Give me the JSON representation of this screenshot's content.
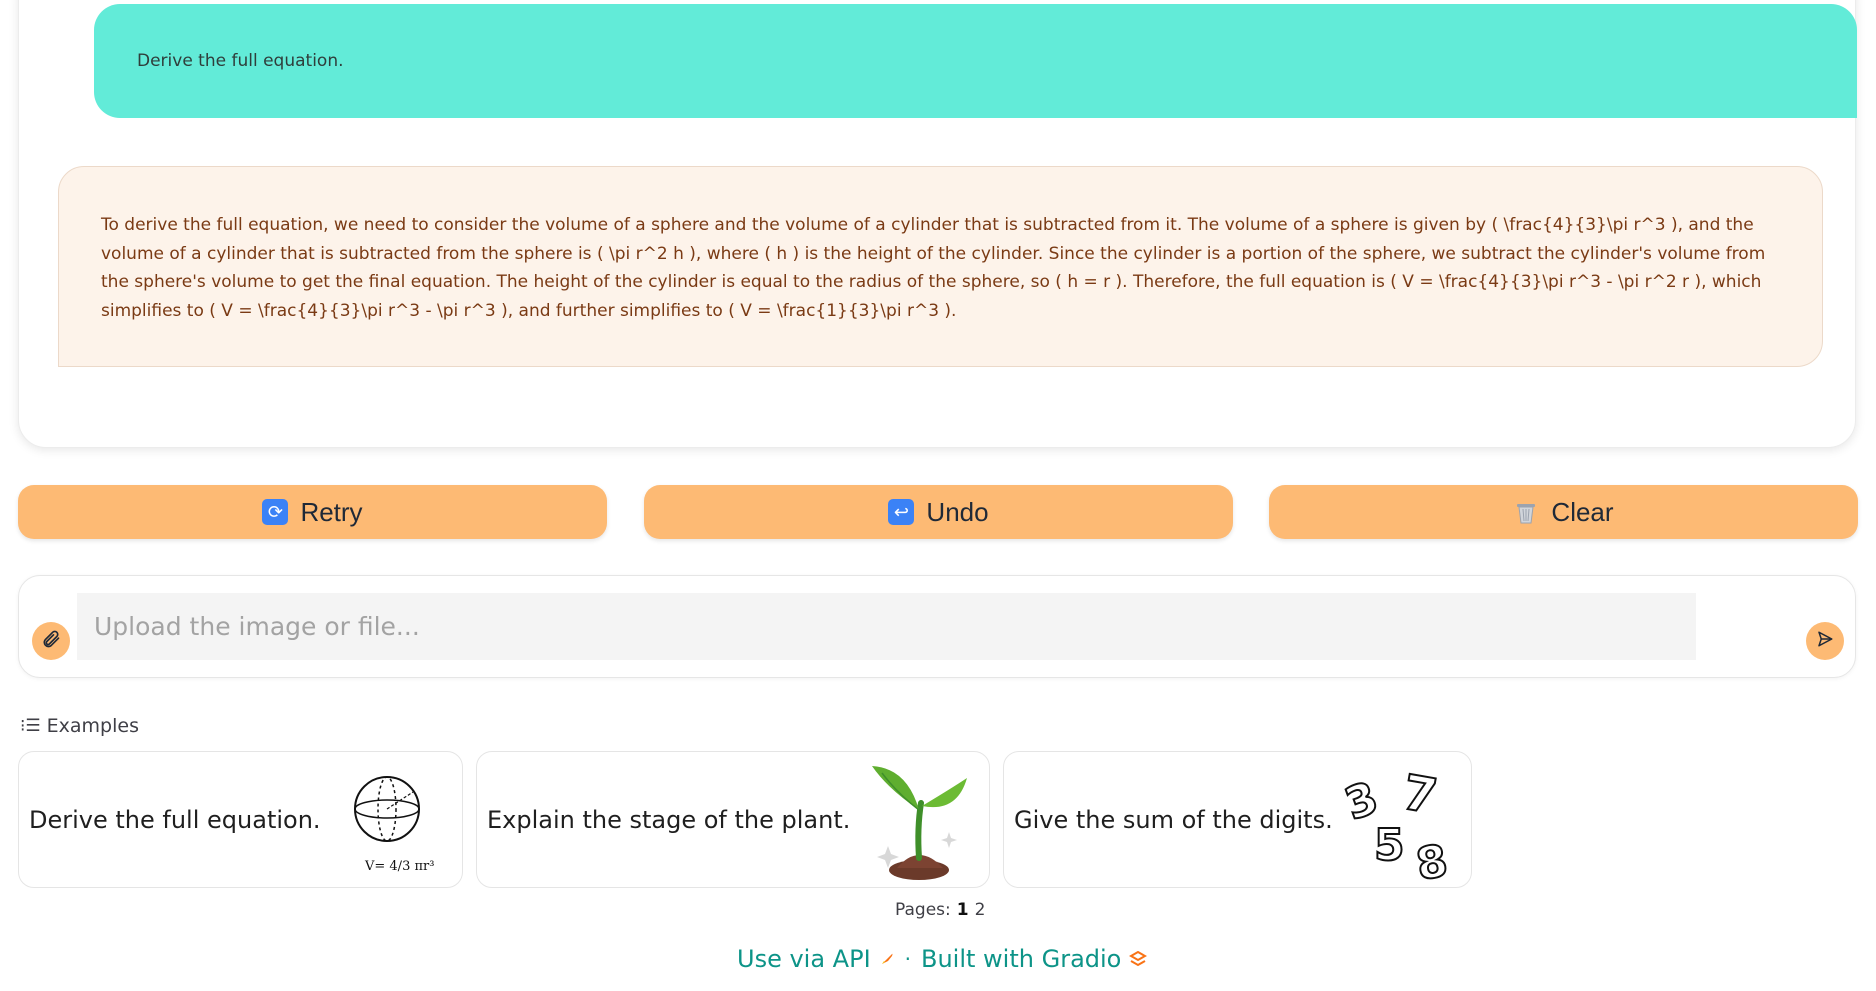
{
  "chat": {
    "user_message": "Derive the full equation.",
    "bot_message": "To derive the full equation, we need to consider the volume of a sphere and the volume of a cylinder that is subtracted from it. The volume of a sphere is given by ( \\frac{4}{3}\\pi r^3 ), and the volume of a cylinder that is subtracted from the sphere is ( \\pi r^2 h ), where ( h ) is the height of the cylinder. Since the cylinder is a portion of the sphere, we subtract the cylinder's volume from the sphere's volume to get the final equation. The height of the cylinder is equal to the radius of the sphere, so ( h = r ). Therefore, the full equation is ( V = \\frac{4}{3}\\pi r^3 - \\pi r^2 r ), which simplifies to ( V = \\frac{4}{3}\\pi r^3 - \\pi r^3 ), and further simplifies to ( V = \\frac{1}{3}\\pi r^3 )."
  },
  "buttons": {
    "retry": {
      "label": "Retry",
      "icon": "🔄"
    },
    "undo": {
      "label": "Undo",
      "icon": "↩"
    },
    "clear": {
      "label": "Clear",
      "icon": "🗑️"
    }
  },
  "input": {
    "placeholder": "Upload the image or file...",
    "value": ""
  },
  "examples": {
    "label": "Examples",
    "items": [
      {
        "text": "Derive the full equation.",
        "image": "sphere-volume-sketch",
        "formula_label": "V= 4/3 πr³"
      },
      {
        "text": "Explain the stage of the plant.",
        "image": "sprouting-plant"
      },
      {
        "text": "Give the sum of the digits.",
        "image": "digits-3578",
        "digits": [
          "3",
          "7",
          "5",
          "8"
        ]
      }
    ]
  },
  "pagination": {
    "label": "Pages:",
    "pages": [
      "1",
      "2"
    ],
    "current": "1"
  },
  "footer": {
    "api_label": "Use via API",
    "separator": "·",
    "built_label": "Built with Gradio"
  },
  "colors": {
    "user_bubble": "#62ebd8",
    "bot_bubble": "#fdf3ea",
    "bot_text": "#7a3a14",
    "button": "#fdba74",
    "footer_link": "#0d9488"
  }
}
